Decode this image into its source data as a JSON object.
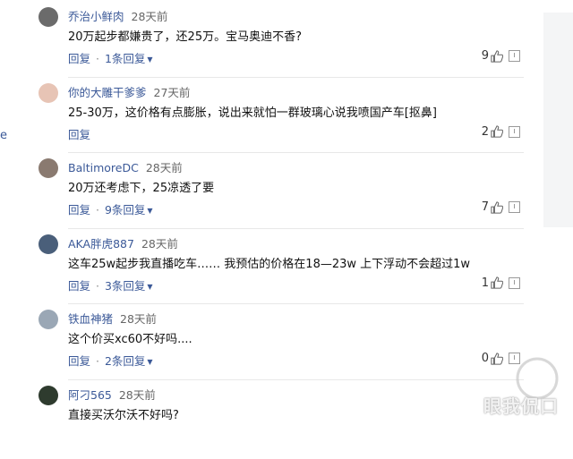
{
  "left_stub": "e",
  "comments": [
    {
      "author": "乔治小鲜肉",
      "time": "28天前",
      "content": "20万起步都嫌贵了，还25万。宝马奥迪不香?",
      "reply": "回复",
      "sub": "1条回复",
      "likes": "9",
      "avatar": "#6b6b6b"
    },
    {
      "author": "你的大雕干爹爹",
      "time": "27天前",
      "content": "25-30万，这价格有点膨胀，说出来就怕一群玻璃心说我喷国产车[抠鼻]",
      "reply": "回复",
      "sub": "",
      "likes": "2",
      "avatar": "#e7c4b5"
    },
    {
      "author": "BaltimoreDC",
      "time": "28天前",
      "content": "20万还考虑下，25凉透了要",
      "reply": "回复",
      "sub": "9条回复",
      "likes": "7",
      "avatar": "#8a7a70"
    },
    {
      "author": "AKA胖虎887",
      "time": "28天前",
      "content": "这车25w起步我直播吃车…… 我预估的价格在18—23w 上下浮动不会超过1w",
      "reply": "回复",
      "sub": "3条回复",
      "likes": "1",
      "avatar": "#4a5f7a"
    },
    {
      "author": "铁血神猪",
      "time": "28天前",
      "content": "这个价买xc60不好吗....",
      "reply": "回复",
      "sub": "2条回复",
      "likes": "0",
      "avatar": "#9aa7b5"
    },
    {
      "author": "阿刁565",
      "time": "28天前",
      "content": "直接买沃尔沃不好吗?",
      "reply": "",
      "sub": "",
      "likes": "",
      "avatar": "#2e3b2e"
    }
  ],
  "watermark": {
    "text": "眼我侃口"
  }
}
